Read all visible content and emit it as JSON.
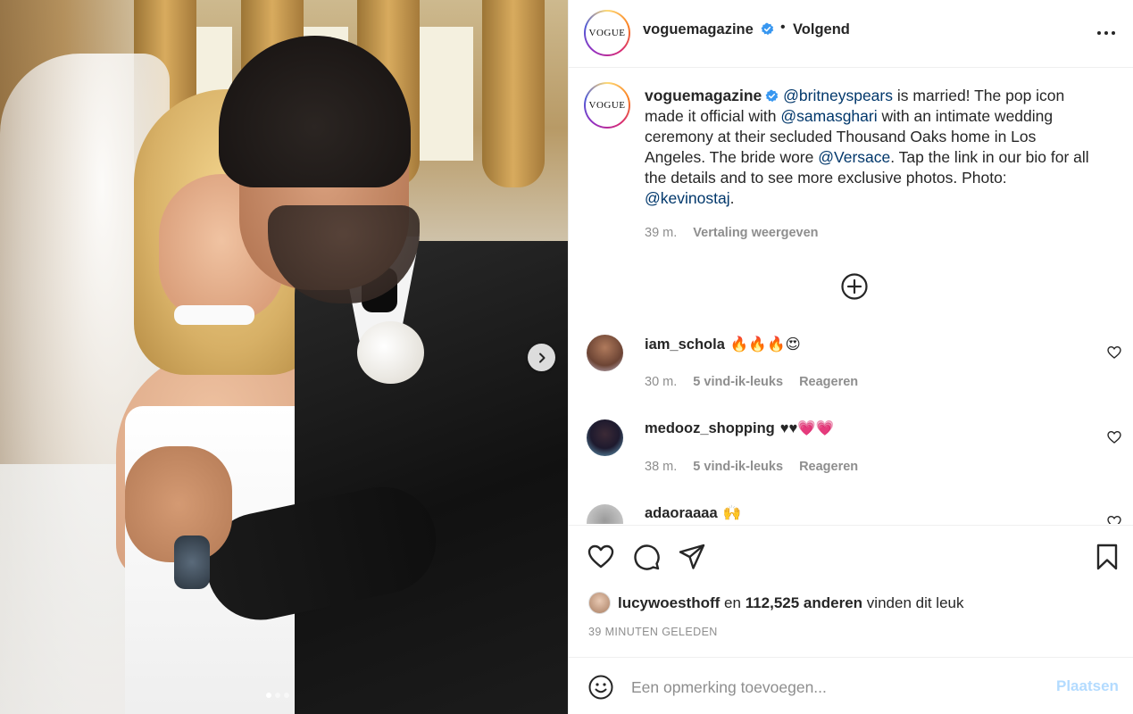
{
  "post": {
    "account": "voguemagazine",
    "avatar_text": "VOGUE",
    "separator": "•",
    "follow_status": "Volgend",
    "caption": {
      "segments": [
        {
          "text": " ",
          "type": "plain"
        },
        {
          "text": "@britneyspears",
          "type": "mention"
        },
        {
          "text": " is married! The pop icon made it official with ",
          "type": "plain"
        },
        {
          "text": "@samasghari",
          "type": "mention"
        },
        {
          "text": " with an intimate wedding ceremony at their secluded Thousand Oaks home in Los Angeles. The bride wore ",
          "type": "plain"
        },
        {
          "text": "@Versace",
          "type": "mention"
        },
        {
          "text": ". Tap the link in our bio for all the details and to see more exclusive photos. Photo: ",
          "type": "plain"
        },
        {
          "text": "@kevinostaj",
          "type": "mention"
        },
        {
          "text": ".",
          "type": "plain"
        }
      ],
      "time": "39 m.",
      "translate_label": "Vertaling weergeven"
    },
    "comments": [
      {
        "user": "iam_schola",
        "text": "🔥🔥🔥😍",
        "time": "30 m.",
        "likes": "5 vind-ik-leuks",
        "reply": "Reageren"
      },
      {
        "user": "medooz_shopping",
        "text": "♥♥💗💗",
        "time": "38 m.",
        "likes": "5 vind-ik-leuks",
        "reply": "Reageren"
      },
      {
        "user": "adaoraaaa",
        "text": "🙌",
        "time": "",
        "likes": "",
        "reply": ""
      }
    ],
    "likes": {
      "user": "lucywoesthoff",
      "connector": "en",
      "count": "112,525 anderen",
      "suffix": "vinden dit leuk"
    },
    "timestamp": "39 MINUTEN GELEDEN",
    "comment_input": {
      "placeholder": "Een opmerking toevoegen...",
      "post_label": "Plaatsen"
    }
  },
  "carousel": {
    "total": 3,
    "current": 1
  },
  "icons": {
    "verified": "verified-badge-icon",
    "more": "more-options-icon",
    "next": "chevron-right-icon",
    "load_more": "plus-circle-icon",
    "like": "heart-icon",
    "comment": "comment-bubble-icon",
    "share": "paper-plane-icon",
    "save": "bookmark-icon",
    "emoji": "smiley-icon"
  },
  "colors": {
    "mention": "#00376b",
    "muted": "#8e8e8e",
    "verified": "#3897f0",
    "post_button_disabled": "#b3dbff"
  }
}
